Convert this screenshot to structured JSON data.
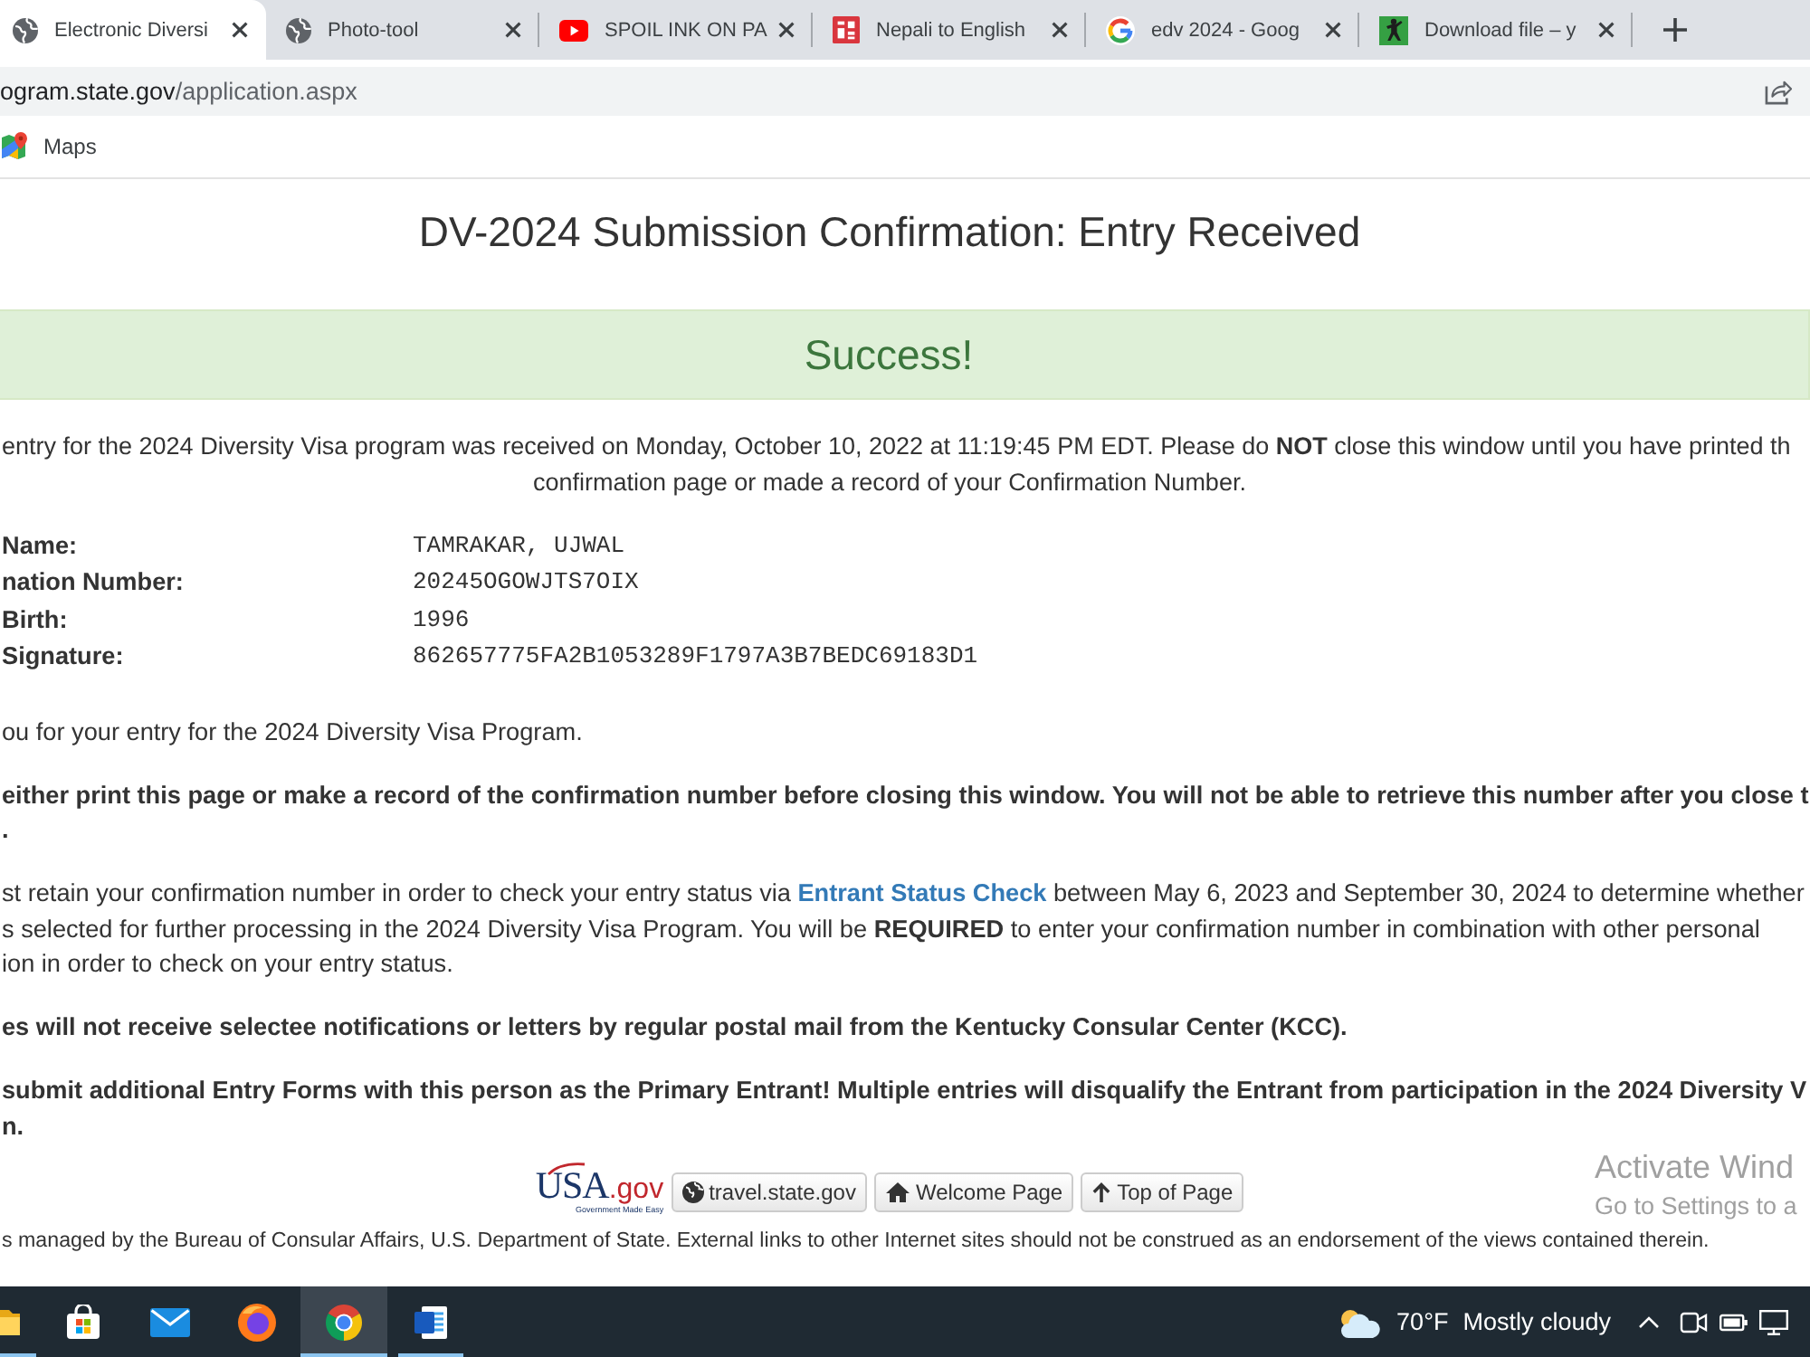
{
  "browser": {
    "tabs": [
      {
        "title": "Electronic Diversi",
        "kind": "globe",
        "selected": true
      },
      {
        "title": "Photo-tool",
        "kind": "globe",
        "selected": false
      },
      {
        "title": "SPOIL INK ON PA",
        "kind": "video",
        "selected": false
      },
      {
        "title": "Nepali to English",
        "kind": "translate",
        "selected": false
      },
      {
        "title": "edv 2024 - Goog",
        "kind": "google",
        "selected": false
      },
      {
        "title": "Download file – y",
        "kind": "figure",
        "selected": false
      }
    ],
    "address": {
      "host": "ogram.state.gov",
      "path": "/application.aspx"
    },
    "bookmarks": [
      {
        "label": "Maps",
        "kind": "maps"
      }
    ]
  },
  "page": {
    "title": "DV-2024 Submission Confirmation: Entry Received",
    "alert": {
      "kind": "success",
      "text": "Success!"
    },
    "notice": [
      "entry for the 2024 Diversity Visa program was received on Monday, October 10, 2022 at 11:19:45 PM EDT. Please do **NOT** close this window until you have printed th",
      "confirmation page or made a record of your Confirmation Number."
    ],
    "details": [
      {
        "label": "Name:",
        "value": "TAMRAKAR, UJWAL"
      },
      {
        "label": "nation Number:",
        "value": "20245OGOWJTS7OIX"
      },
      {
        "label": "Birth:",
        "value": "1996"
      },
      {
        "label": "Signature:",
        "value": "862657775FA2B1053289F1797A3B7BEDC69183D1"
      }
    ],
    "paragraphs": [
      {
        "bold": false,
        "lines": [
          [
            {
              "kind": "text",
              "text": "ou for your entry for the 2024 Diversity Visa Program."
            }
          ]
        ]
      },
      {
        "bold": true,
        "lines": [
          [
            {
              "kind": "text",
              "text": "either print this page or make a record of the confirmation number before closing this window. You will not be able to retrieve this number after you close t"
            }
          ],
          [
            {
              "kind": "text",
              "text": "."
            }
          ]
        ]
      },
      {
        "bold": false,
        "lines": [
          [
            {
              "kind": "text",
              "text": "st retain your confirmation number in order to check your entry status via "
            },
            {
              "kind": "link",
              "text": "Entrant Status Check"
            },
            {
              "kind": "text",
              "text": " between May 6, 2023 and September 30, 2024 to determine whether"
            }
          ],
          [
            {
              "kind": "text",
              "text": "s selected for further processing in the 2024 Diversity Visa Program. You will be **REQUIRED** to enter your confirmation number in combination with other personal"
            }
          ],
          [
            {
              "kind": "text",
              "text": "ion in order to check on your entry status."
            }
          ]
        ]
      },
      {
        "bold": true,
        "lines": [
          [
            {
              "kind": "text",
              "text": "es will not receive selectee notifications or letters by regular postal mail from the Kentucky Consular Center (KCC)."
            }
          ]
        ]
      },
      {
        "bold": true,
        "lines": [
          [
            {
              "kind": "text",
              "text": "submit additional Entry Forms with this person as the Primary Entrant! Multiple entries will disqualify the Entrant from participation in the 2024 Diversity V"
            }
          ],
          [
            {
              "kind": "text",
              "text": "n."
            }
          ]
        ]
      }
    ],
    "footer": {
      "logo": {
        "name": "USA",
        "suffix": ".gov",
        "tagline": "Government Made Easy"
      },
      "buttons": [
        {
          "kind": "globe",
          "label": "travel.state.gov"
        },
        {
          "kind": "home",
          "label": "Welcome Page"
        },
        {
          "kind": "arrow-up",
          "label": "Top of Page"
        }
      ],
      "note": "s managed by the Bureau of Consular Affairs, U.S. Department of State. External links to other Internet sites should not be construed as an endorsement of the views contained therein."
    }
  },
  "os_overlay": {
    "title": "Activate Wind",
    "subtitle": "Go to Settings to a"
  },
  "taskbar": {
    "apps": [
      {
        "kind": "folder",
        "running": true,
        "selected": false
      },
      {
        "kind": "store",
        "running": false,
        "selected": false
      },
      {
        "kind": "mail",
        "running": false,
        "selected": false
      },
      {
        "kind": "firefox",
        "running": false,
        "selected": false
      },
      {
        "kind": "chrome",
        "running": true,
        "selected": true
      },
      {
        "kind": "word",
        "running": true,
        "selected": false
      }
    ],
    "weather": {
      "temperature": "70°F",
      "condition": "Mostly cloudy"
    },
    "tray": [
      {
        "kind": "chevron"
      },
      {
        "kind": "camera"
      },
      {
        "kind": "battery"
      },
      {
        "kind": "monitor"
      }
    ]
  }
}
